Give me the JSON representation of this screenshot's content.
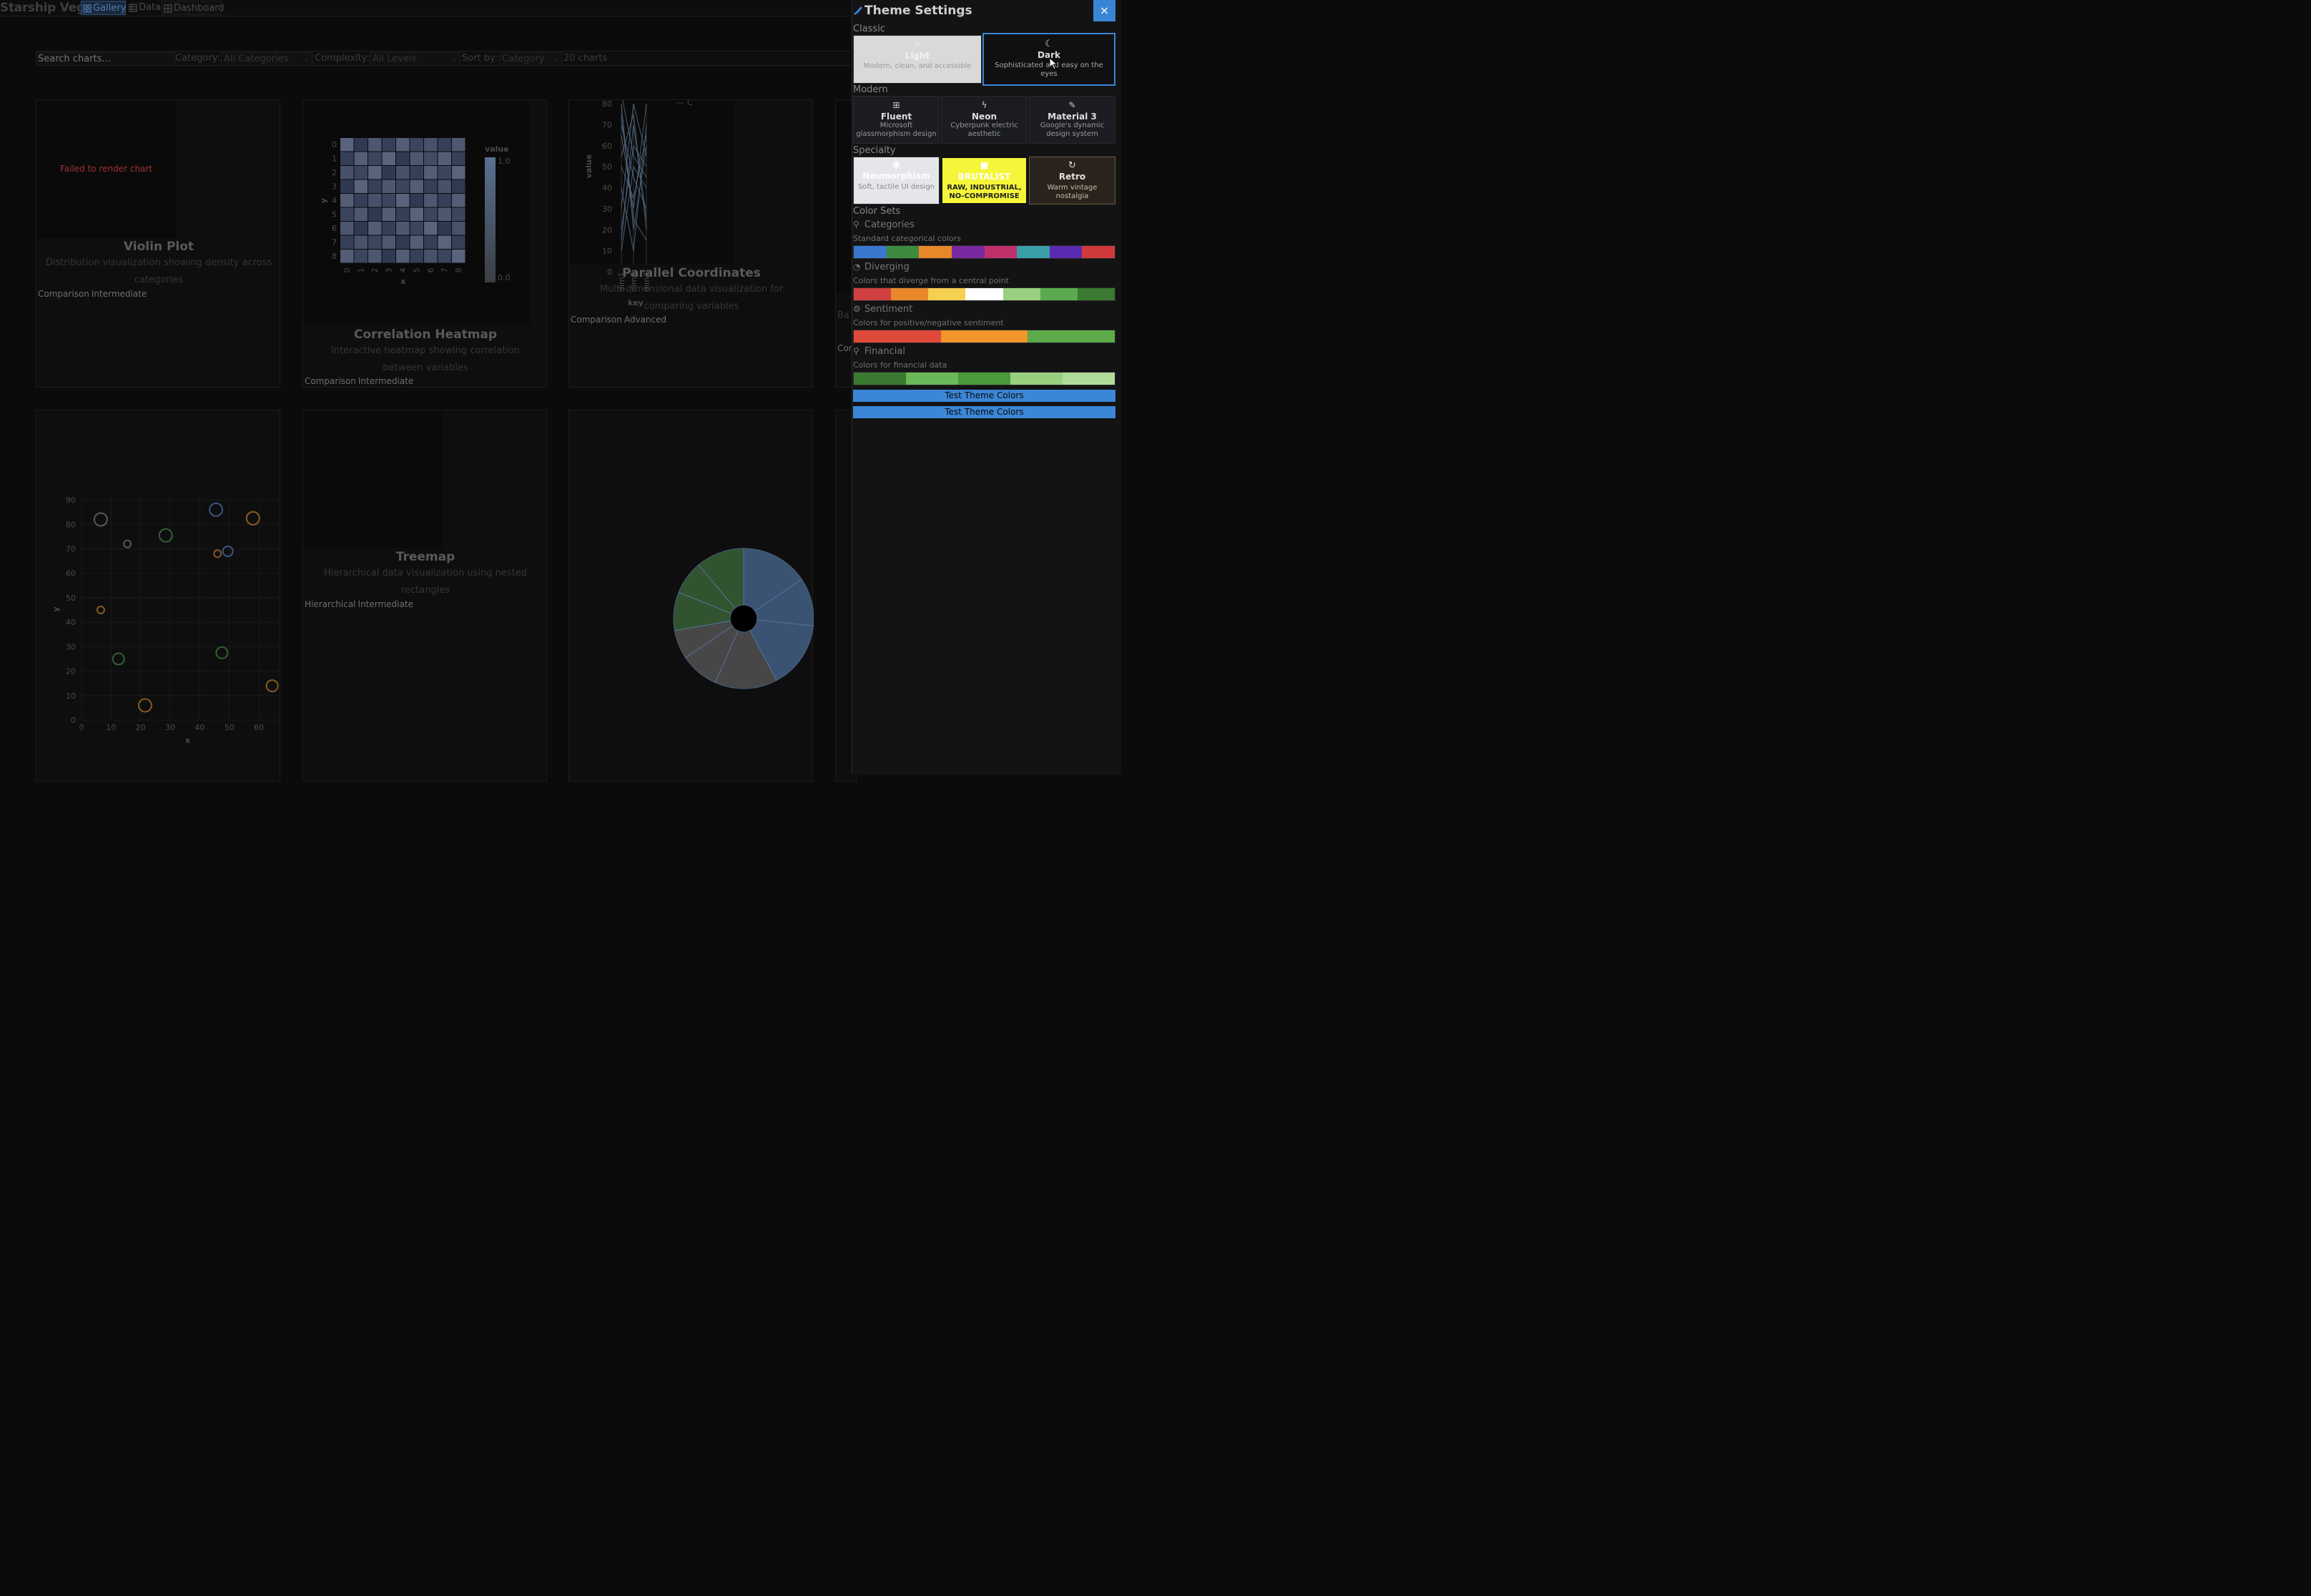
{
  "app": {
    "title": "Starship Vega",
    "nav": [
      {
        "label": "Gallery",
        "icon": "grid-icon",
        "active": true
      },
      {
        "label": "Data",
        "icon": "table-icon",
        "active": false
      },
      {
        "label": "Dashboard",
        "icon": "dashboard-icon",
        "active": false
      }
    ]
  },
  "filters": {
    "search_placeholder": "Search charts...",
    "category_label": "Category:",
    "category_value": "All Categories",
    "complexity_label": "Complexity:",
    "complexity_value": "All Levels",
    "sort_label": "Sort by:",
    "sort_value": "Category",
    "count_text": "20 charts"
  },
  "cards": [
    {
      "title": "Violin Plot",
      "desc": "Distribution visualization showing density across categories",
      "tags": [
        "Comparison",
        "Intermediate"
      ],
      "error": "Failed to render chart"
    },
    {
      "title": "Correlation Heatmap",
      "desc": "Interactive heatmap showing correlation between variables",
      "tags": [
        "Comparison",
        "Intermediate"
      ]
    },
    {
      "title": "Parallel Coordinates",
      "desc": "Multi-dimensional data visualization for comparing variables",
      "tags": [
        "Comparison",
        "Advanced"
      ]
    },
    {
      "title": "Treemap",
      "desc": "Hierarchical data visualization using nested rectangles",
      "tags": [
        "Hierarchical",
        "Intermediate"
      ]
    },
    {
      "partial_desc": "Ba",
      "partial_tag": "Con"
    }
  ],
  "chart_data": [
    {
      "type": "heatmap",
      "x": [
        0,
        1,
        2,
        3,
        4,
        5,
        6,
        7,
        8
      ],
      "y": [
        0,
        1,
        2,
        3,
        4,
        5,
        6,
        7,
        8
      ],
      "xlabel": "x",
      "ylabel": "y",
      "legend_title": "value",
      "legend_range": [
        "0.0",
        "1.0"
      ],
      "values": [
        [
          0.9,
          0.2,
          0.7,
          0.3,
          0.8,
          0.4,
          0.6,
          0.3,
          0.7
        ],
        [
          0.3,
          0.8,
          0.4,
          0.9,
          0.2,
          0.7,
          0.5,
          0.8,
          0.3
        ],
        [
          0.6,
          0.4,
          0.9,
          0.2,
          0.6,
          0.3,
          0.8,
          0.4,
          0.9
        ],
        [
          0.2,
          0.9,
          0.3,
          0.7,
          0.4,
          0.8,
          0.3,
          0.6,
          0.2
        ],
        [
          0.8,
          0.3,
          0.6,
          0.4,
          0.9,
          0.2,
          0.7,
          0.3,
          0.8
        ],
        [
          0.4,
          0.7,
          0.2,
          0.8,
          0.3,
          0.9,
          0.4,
          0.7,
          0.4
        ],
        [
          0.7,
          0.2,
          0.8,
          0.3,
          0.7,
          0.4,
          0.9,
          0.2,
          0.6
        ],
        [
          0.3,
          0.6,
          0.4,
          0.7,
          0.2,
          0.8,
          0.3,
          0.9,
          0.3
        ],
        [
          0.8,
          0.4,
          0.7,
          0.2,
          0.8,
          0.3,
          0.6,
          0.4,
          0.9
        ]
      ]
    },
    {
      "type": "line",
      "subtype": "parallel-coordinates",
      "ylabel": "value",
      "xlabel": "key",
      "yticks": [
        0,
        10,
        20,
        30,
        40,
        50,
        60,
        70,
        80
      ],
      "categories": [
        "dim1",
        "dim2",
        "dim3"
      ],
      "legend": [
        "C"
      ],
      "series": [
        {
          "values": [
            80,
            20,
            60
          ]
        },
        {
          "values": [
            70,
            45,
            30
          ]
        },
        {
          "values": [
            55,
            75,
            20
          ]
        },
        {
          "values": [
            40,
            10,
            70
          ]
        },
        {
          "values": [
            20,
            60,
            50
          ]
        },
        {
          "values": [
            65,
            30,
            80
          ]
        },
        {
          "values": [
            10,
            50,
            40
          ]
        },
        {
          "values": [
            75,
            25,
            15
          ]
        },
        {
          "values": [
            30,
            80,
            55
          ]
        },
        {
          "values": [
            50,
            35,
            65
          ]
        },
        {
          "values": [
            15,
            70,
            25
          ]
        },
        {
          "values": [
            85,
            55,
            45
          ]
        }
      ]
    },
    {
      "type": "scatter",
      "xlabel": "x",
      "ylabel": "y",
      "xticks": [
        0,
        10,
        20,
        30,
        40,
        50,
        60
      ],
      "yticks": [
        0,
        10,
        20,
        30,
        40,
        50,
        60,
        70,
        80,
        90
      ],
      "xlim": [
        0,
        67
      ],
      "ylim": [
        0,
        95
      ],
      "points": [
        {
          "x": 6.5,
          "y": 82,
          "r": 9,
          "c": "#8a8a8a"
        },
        {
          "x": 15.5,
          "y": 72,
          "r": 5,
          "c": "#8a8a8a"
        },
        {
          "x": 28.5,
          "y": 75.5,
          "r": 9,
          "c": "#4a9a4a"
        },
        {
          "x": 45.5,
          "y": 86,
          "r": 9,
          "c": "#5a88c8"
        },
        {
          "x": 58,
          "y": 82.5,
          "r": 9,
          "c": "#d8902a"
        },
        {
          "x": 46,
          "y": 68,
          "r": 5,
          "c": "#d8902a"
        },
        {
          "x": 49.5,
          "y": 69,
          "r": 7,
          "c": "#5a88c8"
        },
        {
          "x": 6.5,
          "y": 45,
          "r": 5,
          "c": "#d8902a"
        },
        {
          "x": 12.5,
          "y": 25,
          "r": 8,
          "c": "#4a9a4a"
        },
        {
          "x": 47.5,
          "y": 27.5,
          "r": 8,
          "c": "#4a9a4a"
        },
        {
          "x": 21.5,
          "y": 6,
          "r": 9,
          "c": "#d8902a"
        },
        {
          "x": 64.5,
          "y": 14,
          "r": 8,
          "c": "#d8902a"
        }
      ]
    },
    {
      "type": "pie",
      "subtype": "donut",
      "values": [
        14,
        10,
        14,
        13,
        8,
        6,
        8,
        7,
        10
      ],
      "colors": [
        "#4a6a94",
        "#4a6a94",
        "#4a6a94",
        "#5a5a5a",
        "#5a5a5a",
        "#5a5a5a",
        "#3f6a3a",
        "#3f6a3a",
        "#3f6a3a"
      ]
    }
  ],
  "panel": {
    "title": "Theme Settings",
    "close_label": "×",
    "sections": {
      "classic": "Classic",
      "modern": "Modern",
      "specialty": "Specialty",
      "colorsets": "Color Sets"
    },
    "themes": {
      "light": {
        "name": "Light",
        "desc": "Modern, clean, and accessible"
      },
      "dark": {
        "name": "Dark",
        "desc": "Sophisticated and easy on the eyes"
      },
      "fluent": {
        "name": "Fluent",
        "desc": "Microsoft glassmorphism design"
      },
      "neon": {
        "name": "Neon",
        "desc": "Cyberpunk electric aesthetic"
      },
      "material": {
        "name": "Material 3",
        "desc": "Google's dynamic design system"
      },
      "neumorphism": {
        "name": "Neumorphism",
        "desc": "Soft, tactile UI design"
      },
      "brutalist": {
        "name": "BRUTALIST",
        "desc": "RAW, INDUSTRIAL, NO-COMPROMISE"
      },
      "retro": {
        "name": "Retro",
        "desc": "Warm vintage nostalgia"
      }
    },
    "color_sets": [
      {
        "name": "Categories",
        "desc": "Standard categorical colors",
        "colors": [
          "#3a78d0",
          "#3f8a3f",
          "#e8862a",
          "#7a2aa0",
          "#c0306a",
          "#3aa0a8",
          "#5a2ab0",
          "#d03a3a"
        ]
      },
      {
        "name": "Diverging",
        "desc": "Colors that diverge from a central point",
        "colors": [
          "#d04040",
          "#e8882a",
          "#f5cf50",
          "#ffffff",
          "#98d080",
          "#5caa50",
          "#3a7a30"
        ]
      },
      {
        "name": "Sentiment",
        "desc": "Colors for positive/negative sentiment",
        "colors": [
          "#e04a3a",
          "#f0962a",
          "#5caa4a"
        ]
      },
      {
        "name": "Financial",
        "desc": "Colors for financial data",
        "colors": [
          "#3a7a30",
          "#6ab85a",
          "#4a9a3a",
          "#98d080",
          "#b0dc9a"
        ]
      }
    ],
    "test_button_label": "Test Theme Colors"
  }
}
